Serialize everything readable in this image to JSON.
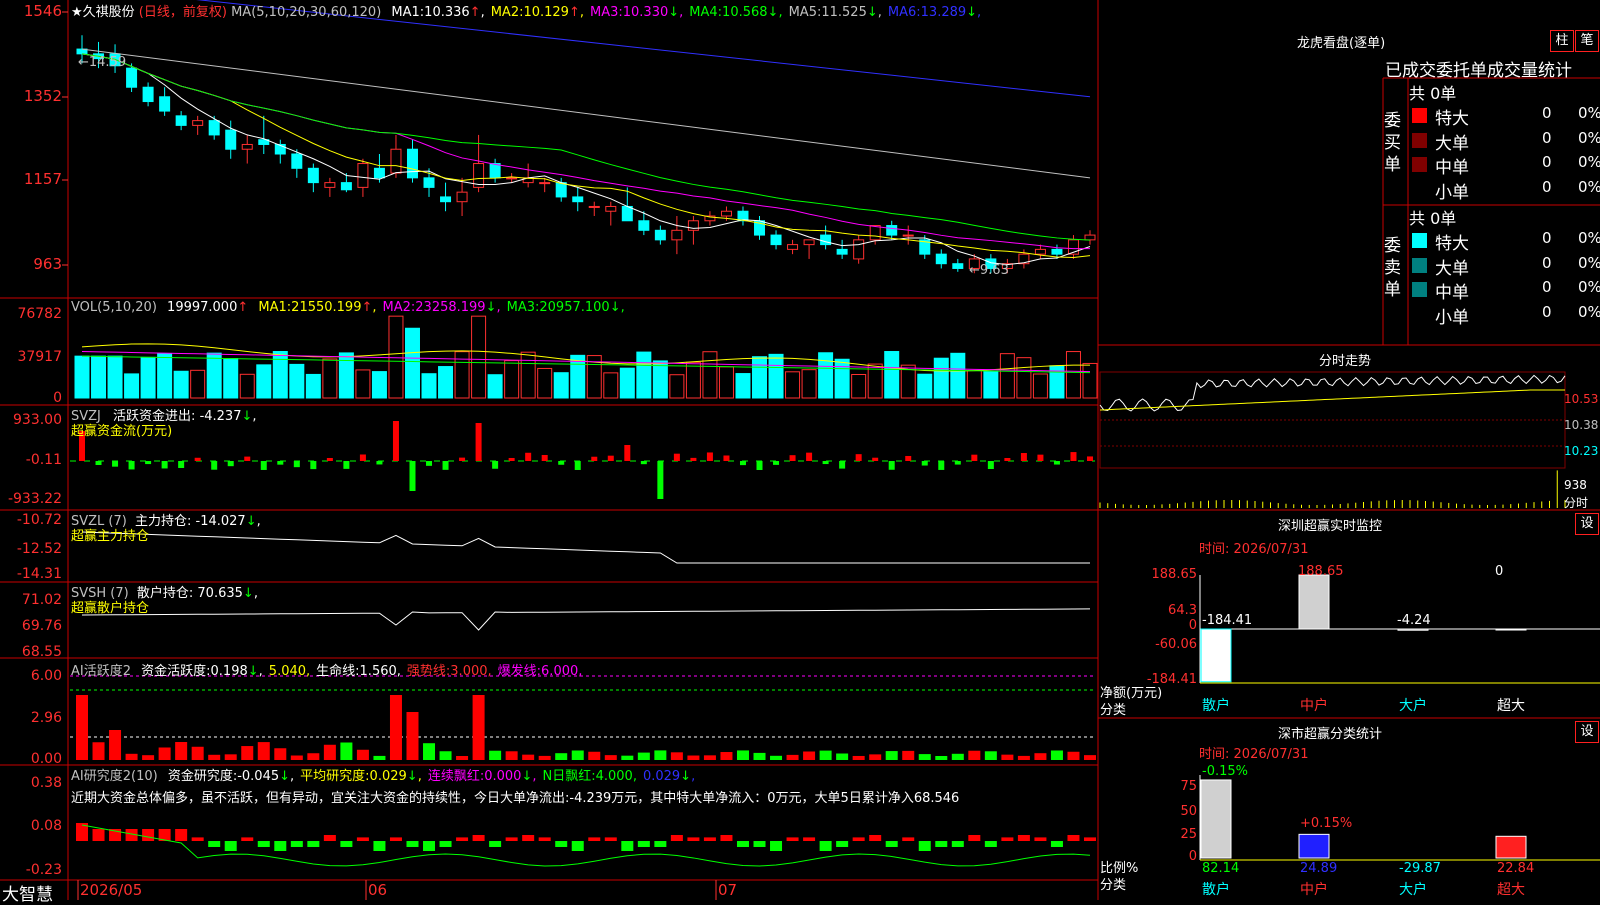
{
  "app": {
    "brand": "大智慧"
  },
  "header": {
    "stock_name": "★久祺股份",
    "period_label": "(日线，前复权)",
    "ma_params": "MA(5,10,20,30,60,120)",
    "ma_values": [
      {
        "label": "MA1:",
        "value": "10.336",
        "arrow": "↑",
        "color": "#ffffff"
      },
      {
        "label": "MA2:",
        "value": "10.129",
        "arrow": "↑",
        "color": "#ffff00"
      },
      {
        "label": "MA3:",
        "value": "10.330",
        "arrow": "↓",
        "color": "#ff00ff"
      },
      {
        "label": "MA4:",
        "value": "10.568",
        "arrow": "↓",
        "color": "#00ff00"
      },
      {
        "label": "MA5:",
        "value": "11.525",
        "arrow": "↓",
        "color": "#c0c0c0"
      },
      {
        "label": "MA6:",
        "value": "13.289",
        "arrow": "↓",
        "color": "#3030ff"
      }
    ]
  },
  "price_axis": [
    "1546",
    "1352",
    "1157",
    "963"
  ],
  "price_annotations": {
    "high": "14.59",
    "low": "9.63"
  },
  "volume": {
    "title": "VOL(5,10,20)",
    "value": "19997.000",
    "value_arrow": "↑",
    "mas": [
      {
        "label": "MA1:",
        "value": "21550.199",
        "arrow": "↑",
        "color": "#ffff00"
      },
      {
        "label": "MA2:",
        "value": "23258.199",
        "arrow": "↓",
        "color": "#ff00ff"
      },
      {
        "label": "MA3:",
        "value": "20957.100",
        "arrow": "↓",
        "color": "#00ff00"
      }
    ],
    "axis": [
      "76782",
      "37917",
      "0"
    ]
  },
  "svzj": {
    "title": "SVZJ",
    "label": "活跃资金进出:",
    "value": "-4.237",
    "arrow": "↓",
    "sub": "超赢资金流(万元)",
    "axis": [
      "933.00",
      "-0.11",
      "-933.22"
    ]
  },
  "svzl": {
    "title": "SVZL (7)",
    "label": "主力持仓:",
    "value": "-14.027",
    "arrow": "↓",
    "sub": "超赢主力持仓",
    "axis": [
      "-10.72",
      "-12.52",
      "-14.31"
    ]
  },
  "svsh": {
    "title": "SVSH (7)",
    "label": "散户持仓:",
    "value": "70.635",
    "arrow": "↓",
    "sub": "超赢散户持仓",
    "axis": [
      "71.02",
      "69.76",
      "68.55"
    ]
  },
  "ai_active": {
    "title": "AI活跃度2",
    "items": [
      {
        "label": "资金活跃度:",
        "value": "0.198",
        "arrow": "↓",
        "color": "#ffffff"
      },
      {
        "label": "",
        "value": "5.040",
        "arrow": "",
        "color": "#ffff00"
      },
      {
        "label": "生命线:",
        "value": "1.560",
        "arrow": "",
        "color": "#ffffff"
      },
      {
        "label": "强势线:",
        "value": "3.000",
        "arrow": "",
        "color": "#ff3030"
      },
      {
        "label": "爆发线:",
        "value": "6.000",
        "arrow": "",
        "color": "#ff00ff"
      }
    ],
    "axis": [
      "6.00",
      "2.96",
      "0.00"
    ]
  },
  "ai_research": {
    "title": "AI研究度2(10)",
    "items": [
      {
        "label": "资金研究度:",
        "value": "-0.045",
        "arrow": "↓",
        "color": "#ffffff"
      },
      {
        "label": "平均研究度:",
        "value": "0.029",
        "arrow": "↓",
        "color": "#ffff00"
      },
      {
        "label": "连续飘红:",
        "value": "0.000",
        "arrow": "↓",
        "color": "#ff00ff"
      },
      {
        "label": "N日飘红:",
        "value": "4.000",
        "arrow": "",
        "color": "#00ff00"
      },
      {
        "label": "",
        "value": "0.029",
        "arrow": "↓",
        "color": "#3030ff"
      }
    ],
    "comment": "近期大资金总体偏多，虽不活跃，但有异动，宜关注大资金的持续性，今日大单净流出:-4.239万元，其中特大单净流入：0万元，大单5日累计净入68.546",
    "axis": [
      "0.38",
      "0.08",
      "-0.23"
    ]
  },
  "date_axis": [
    "2026/05",
    "06",
    "07"
  ],
  "right": {
    "lhb": {
      "title": "龙虎看盘(逐单)",
      "btn1": "柱",
      "btn2": "笔",
      "subtitle": "已成交委托单成交量统计",
      "buy": {
        "group": "委买单",
        "total": "共 0单",
        "rows": [
          {
            "name": "特大",
            "count": "0",
            "pct": "0%",
            "color": "#ff0000"
          },
          {
            "name": "大单",
            "count": "0",
            "pct": "0%",
            "color": "#800000"
          },
          {
            "name": "中单",
            "count": "0",
            "pct": "0%",
            "color": "#800000"
          },
          {
            "name": "小单",
            "count": "0",
            "pct": "0%",
            "color": "#000000"
          }
        ]
      },
      "sell": {
        "group": "委卖单",
        "total": "共 0单",
        "rows": [
          {
            "name": "特大",
            "count": "0",
            "pct": "0%",
            "color": "#00ffff"
          },
          {
            "name": "大单",
            "count": "0",
            "pct": "0%",
            "color": "#008080"
          },
          {
            "name": "中单",
            "count": "0",
            "pct": "0%",
            "color": "#008080"
          },
          {
            "name": "小单",
            "count": "0",
            "pct": "0%",
            "color": "#000000"
          }
        ]
      }
    },
    "fenshi": {
      "title": "分时走势",
      "axis": [
        "10.53",
        "10.38",
        "10.23"
      ],
      "vol_value": "938",
      "vol_label": "分时"
    },
    "monitor": {
      "title": "深圳超赢实时监控",
      "settings": "设",
      "time_label": "时间:",
      "time": "2026/07/31",
      "axis": [
        "188.65",
        "64.3",
        "0",
        "-60.06",
        "-184.41"
      ],
      "y_label": "净额(万元)",
      "x_label": "分类",
      "bars": [
        {
          "cat": "散户",
          "value": "-184.41"
        },
        {
          "cat": "中户",
          "value": "188.65"
        },
        {
          "cat": "大户",
          "value": "-4.24"
        },
        {
          "cat": "超大",
          "value": "0"
        }
      ]
    },
    "classify": {
      "title": "深市超赢分类统计",
      "settings": "设",
      "time_label": "时间:",
      "time": "2026/07/31",
      "axis": [
        "75",
        "50",
        "25",
        "0"
      ],
      "y_label": "比例%",
      "x_label": "分类",
      "bars": [
        {
          "cat": "散户",
          "value": "82.14",
          "delta": "-0.15%"
        },
        {
          "cat": "中户",
          "value": "24.89",
          "delta": "+0.15%"
        },
        {
          "cat": "大户",
          "value": "-29.87",
          "delta": ""
        },
        {
          "cat": "超大",
          "value": "22.84",
          "delta": ""
        }
      ]
    }
  },
  "chart_data": {
    "type": "candlestick",
    "dates_shown": [
      "2026/05",
      "06",
      "07"
    ],
    "ohlc": [
      [
        14.3,
        14.59,
        14.0,
        14.2
      ],
      [
        14.2,
        14.45,
        13.9,
        14.1
      ],
      [
        14.2,
        14.4,
        13.8,
        13.95
      ],
      [
        13.9,
        14.0,
        13.4,
        13.5
      ],
      [
        13.5,
        13.6,
        13.1,
        13.2
      ],
      [
        13.3,
        13.5,
        12.9,
        13.0
      ],
      [
        12.9,
        13.0,
        12.6,
        12.7
      ],
      [
        12.7,
        12.9,
        12.5,
        12.8
      ],
      [
        12.8,
        12.9,
        12.4,
        12.5
      ],
      [
        12.6,
        12.8,
        12.0,
        12.2
      ],
      [
        12.2,
        12.5,
        11.9,
        12.3
      ],
      [
        12.4,
        12.9,
        12.1,
        12.3
      ],
      [
        12.3,
        12.4,
        11.9,
        12.1
      ],
      [
        12.1,
        12.2,
        11.6,
        11.8
      ],
      [
        11.8,
        11.9,
        11.3,
        11.5
      ],
      [
        11.4,
        11.6,
        11.2,
        11.5
      ],
      [
        11.5,
        11.7,
        11.3,
        11.35
      ],
      [
        11.4,
        12.0,
        11.2,
        11.9
      ],
      [
        11.8,
        12.1,
        11.5,
        11.6
      ],
      [
        11.7,
        12.5,
        11.6,
        12.2
      ],
      [
        12.2,
        12.4,
        11.5,
        11.6
      ],
      [
        11.6,
        11.8,
        11.2,
        11.4
      ],
      [
        11.2,
        11.5,
        10.9,
        11.1
      ],
      [
        11.1,
        11.6,
        10.8,
        11.3
      ],
      [
        11.4,
        12.5,
        11.3,
        11.9
      ],
      [
        11.9,
        12.0,
        11.5,
        11.6
      ],
      [
        11.6,
        11.7,
        11.5,
        11.6
      ],
      [
        11.5,
        11.9,
        11.4,
        11.6
      ],
      [
        11.5,
        11.6,
        11.3,
        11.5
      ],
      [
        11.5,
        11.6,
        11.1,
        11.2
      ],
      [
        11.2,
        11.4,
        10.9,
        11.1
      ],
      [
        11.0,
        11.1,
        10.8,
        11.0
      ],
      [
        10.9,
        11.1,
        10.6,
        11.0
      ],
      [
        11.0,
        11.4,
        10.8,
        10.7
      ],
      [
        10.7,
        10.9,
        10.4,
        10.5
      ],
      [
        10.5,
        10.6,
        10.2,
        10.3
      ],
      [
        10.3,
        10.8,
        10.0,
        10.5
      ],
      [
        10.5,
        10.8,
        10.2,
        10.7
      ],
      [
        10.7,
        10.9,
        10.6,
        10.8
      ],
      [
        10.8,
        11.0,
        10.7,
        10.9
      ],
      [
        10.9,
        11.0,
        10.6,
        10.7
      ],
      [
        10.7,
        10.8,
        10.3,
        10.4
      ],
      [
        10.4,
        10.5,
        10.1,
        10.2
      ],
      [
        10.1,
        10.3,
        10.0,
        10.2
      ],
      [
        10.2,
        10.3,
        9.9,
        10.3
      ],
      [
        10.4,
        10.6,
        10.1,
        10.2
      ],
      [
        10.1,
        10.3,
        9.9,
        10.0
      ],
      [
        9.9,
        10.4,
        9.8,
        10.3
      ],
      [
        10.3,
        10.6,
        10.2,
        10.6
      ],
      [
        10.6,
        10.7,
        10.3,
        10.4
      ],
      [
        10.4,
        10.6,
        10.2,
        10.4
      ],
      [
        10.3,
        10.4,
        9.9,
        10.0
      ],
      [
        10.0,
        10.1,
        9.7,
        9.8
      ],
      [
        9.8,
        9.9,
        9.63,
        9.7
      ],
      [
        9.7,
        10.0,
        9.6,
        9.9
      ],
      [
        9.9,
        10.0,
        9.6,
        9.7
      ],
      [
        9.7,
        9.9,
        9.6,
        9.8
      ],
      [
        9.8,
        10.1,
        9.7,
        10.0
      ],
      [
        10.0,
        10.2,
        9.9,
        10.1
      ],
      [
        10.1,
        10.2,
        9.9,
        10.0
      ],
      [
        10.0,
        10.4,
        9.9,
        10.3
      ],
      [
        10.3,
        10.5,
        10.2,
        10.4
      ]
    ]
  }
}
